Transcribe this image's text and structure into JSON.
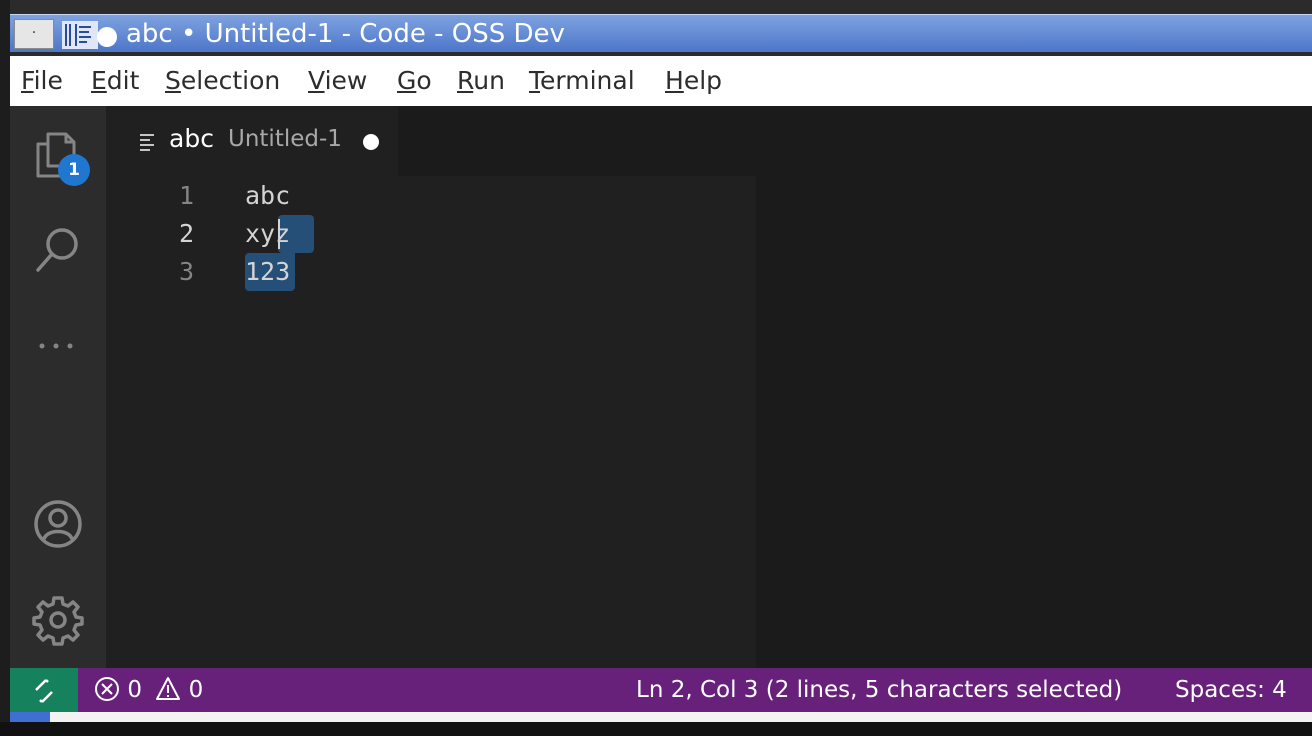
{
  "window": {
    "title": "abc • Untitled-1 - Code - OSS Dev",
    "control_glyph": "·"
  },
  "menu": [
    {
      "label": "File",
      "mnemonic": "F",
      "rest": "ile"
    },
    {
      "label": "Edit",
      "mnemonic": "E",
      "rest": "dit"
    },
    {
      "label": "Selection",
      "mnemonic": "S",
      "rest": "election"
    },
    {
      "label": "View",
      "mnemonic": "V",
      "rest": "iew"
    },
    {
      "label": "Go",
      "mnemonic": "G",
      "rest": "o"
    },
    {
      "label": "Run",
      "mnemonic": "R",
      "rest": "un"
    },
    {
      "label": "Terminal",
      "mnemonic": "T",
      "rest": "erminal"
    },
    {
      "label": "Help",
      "mnemonic": "H",
      "rest": "elp"
    }
  ],
  "activity_bar": {
    "explorer_badge": "1",
    "icons": [
      "files-icon",
      "search-icon",
      "more-icon",
      "account-icon",
      "gear-icon"
    ]
  },
  "tab": {
    "name": "abc",
    "description": "Untitled-1",
    "dirty": true
  },
  "editor": {
    "lines": [
      {
        "number": "1",
        "text": "abc"
      },
      {
        "number": "2",
        "text": "xyz"
      },
      {
        "number": "3",
        "text": "123"
      }
    ],
    "active_line": 2
  },
  "status": {
    "errors": "0",
    "warnings": "0",
    "cursor_info": "Ln 2, Col 3 (2 lines, 5 characters selected)",
    "indent": "Spaces: 4"
  },
  "colors": {
    "status_bar": "#68217a",
    "remote_indicator": "#16825d",
    "badge": "#1f77d0",
    "selection": "#264f78",
    "title_bar": "#5a82d2"
  }
}
